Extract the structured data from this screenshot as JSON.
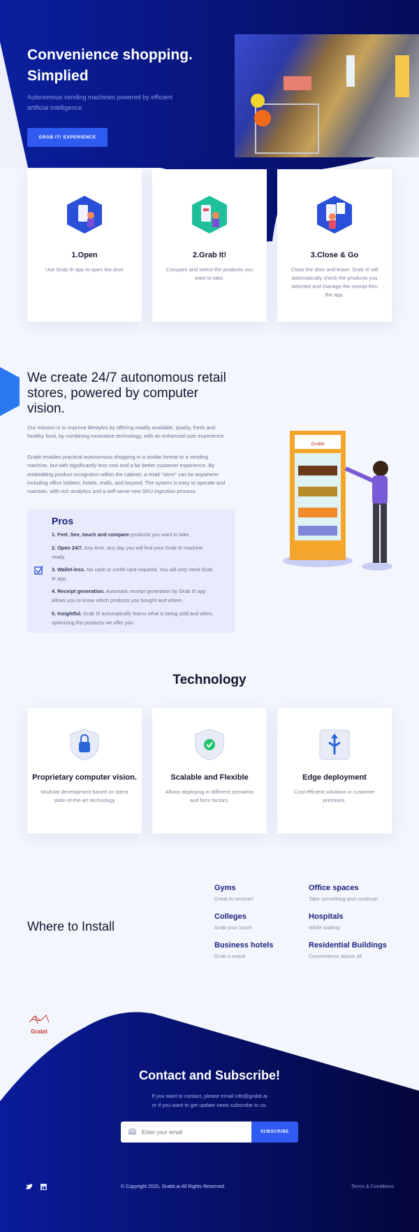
{
  "hero": {
    "title_line1": "Convenience shopping.",
    "title_line2": "Simplied",
    "subtitle": "Autonomous vending machines powered by efficient artificial intelligence.",
    "cta": "GRAB IT! EXPERIENCE"
  },
  "steps": [
    {
      "title": "1.Open",
      "text": "Use Grab It! app to open the door"
    },
    {
      "title": "2.Grab It!",
      "text": "Compare and select the products you want to take."
    },
    {
      "title": "3.Close & Go",
      "text": "Close the door and leave. Grab it! will automatically check the products you selected and manage the receipt thru the app."
    }
  ],
  "about": {
    "title": "We create 24/7 autonomous retail stores, powered by computer vision.",
    "p1": "Our mission is to improve lifestyles by offering readily available, quality, fresh and healthy food, by combining innovative technology, with an enhanced user experience.",
    "p2": "Grabit enables practical autonomous shopping in a similar format to a vending machine, but with significantly less cost and a far better customer experience. By embedding product recognition within the cabinet, a retail \"store\" can be anywhere: including office lobbies, hotels, malls, and beyond. The system is easy to operate and maintain, with rich analytics and a self-serve new SKU ingestion process.",
    "machine_label": "Grabit"
  },
  "pros": {
    "title": "Pros",
    "items": [
      {
        "bold": "1. Feel. See, touch and compare",
        "text": " products you want to take."
      },
      {
        "bold": "2. Open 24/7.",
        "text": " Any time, any day you will find your Grab It! machine ready."
      },
      {
        "bold": "3. Wallet-less.",
        "text": " No cash or credit card required. You will only need Grab It! app."
      },
      {
        "bold": "4. Receipt generation.",
        "text": " Automatic receipt generation by Grab It! app allows you to know which products you bought and where."
      },
      {
        "bold": "5. Insightful.",
        "text": " Grab It! automatically learns what is being sold and when, optimizing the products we offer you."
      }
    ]
  },
  "technology": {
    "title": "Technology",
    "cards": [
      {
        "title": "Proprietary computer vision.",
        "text": "Modular development based on latest state-of-the-art technology"
      },
      {
        "title": "Scalable and Flexible",
        "text": "Allows deploying in different scenarios and form factors."
      },
      {
        "title": "Edge deployment",
        "text": "Cost efficient solutions in customer premises."
      }
    ]
  },
  "where": {
    "title": "Where to Install",
    "places": [
      {
        "name": "Gyms",
        "desc": "Great to recover!"
      },
      {
        "name": "Office spaces",
        "desc": "Take something and continue!"
      },
      {
        "name": "Colleges",
        "desc": "Grab your lunch"
      },
      {
        "name": "Hospitals",
        "desc": "While waiting"
      },
      {
        "name": "Business hotels",
        "desc": "Grab a snack"
      },
      {
        "name": "Residential Buildings",
        "desc": "Convenience above all"
      }
    ]
  },
  "logo": "Grabit",
  "contact": {
    "title": "Contact and Subscribe!",
    "line1": "If you want to contact, please email info@grabit.ai",
    "line2": "or if you want to get update news subscribe to us.",
    "placeholder": "Enter your email",
    "button": "SUBSCRIBE"
  },
  "footer": {
    "copyright": "© Copyright 2020, Grabit.ai All Rights Reserved.",
    "terms": "Terms & Conditions"
  },
  "colors": {
    "navy": "#0a1a8c",
    "accent": "#2f5bf0",
    "heading": "#1d237e"
  }
}
